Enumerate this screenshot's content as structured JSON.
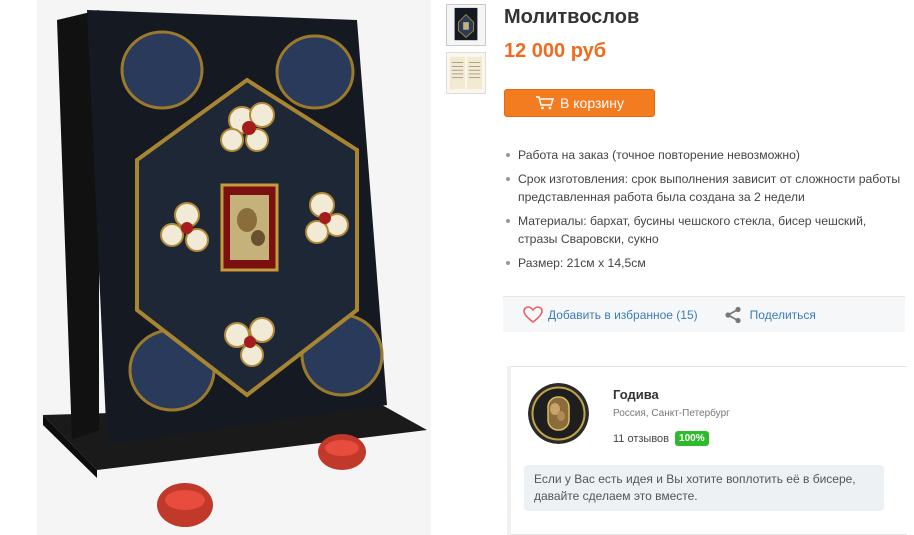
{
  "product": {
    "title": "Молитвослов",
    "price": "12 000 руб",
    "cart_label": "В корзину"
  },
  "details": [
    "Работа на заказ  (точное повторение невозможно)",
    "Срок изготовления: срок выполнения зависит от сложности работы",
    "представленная работа была создана за 2 недели",
    "Материалы:  бархат, бусины чешского стекла, бисер чешский, стразы Сваровски, сукно",
    "Размер: 21см х 14,5см"
  ],
  "actions": {
    "favorite_label": "Добавить в избранное (15)",
    "share_label": "Поделиться"
  },
  "seller": {
    "name": "Годива",
    "location": "Россия, Санкт-Петербург",
    "reviews": "11 отзывов",
    "rating_badge": "100%",
    "message": "Если у Вас есть идея и Вы хотите воплотить её в бисере, давайте сделаем это вместе."
  },
  "colors": {
    "accent_orange": "#f47c20",
    "price_orange": "#f26b1d",
    "link_blue": "#3b7bbf",
    "badge_green": "#2dbb2d"
  },
  "icons": [
    "cart-icon",
    "heart-icon",
    "share-icon"
  ]
}
